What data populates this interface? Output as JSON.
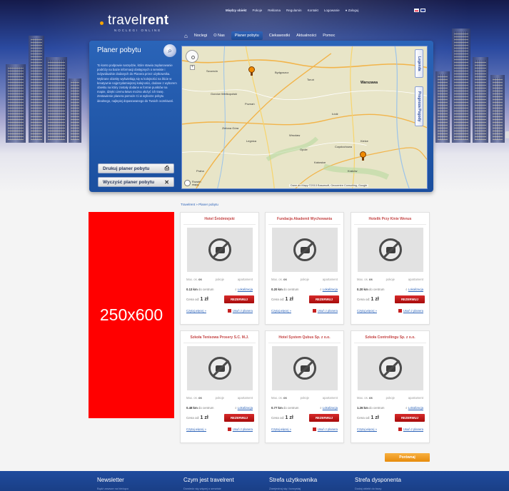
{
  "brand": {
    "name_light": "travel",
    "name_bold": "rent",
    "tagline": "NOCLEGI ONLINE",
    "accent": "#f7a400"
  },
  "top_nav": [
    "Między obiekt",
    "Pokoje",
    "Reklama",
    "Regulamin",
    "Kontakt",
    "Logowanie",
    "Zaloguj"
  ],
  "language_flags": [
    "pl",
    "en"
  ],
  "main_nav": {
    "home_icon": "home-icon",
    "items": [
      "Noclegi",
      "O Nas",
      "Planer pobytu",
      "Ciekawostki",
      "Aktualności",
      "Pomoc"
    ],
    "active": "Planer pobytu"
  },
  "planner": {
    "title": "Planer pobytu",
    "description": "To konto podpowie narzędzie, które stawia zaplanowanie podróży na bazie informacji dostępnych o serwisie i indywidualnie dodanych do Planera przez użytkownika. Wybrane obiekty wyświetlają się w kolejności na liście w kreatywnie najprzydatniejszej kolejności, dodane z wyborem obiektu na który zostały dodane w formie punktów na mapie, dzięki czemu łatwo można ułożyć ich trasę. Zestawienie planera pomoże Ci w wyborze pobytu idealnego, najlepiej dopasowanego do Twoich oczekiwań.",
    "buttons": {
      "print": "Drukuj planer pobytu",
      "clear": "Wyczyść planer pobytu"
    },
    "side_tabs": [
      "Legenda",
      "Prognoza Pogody"
    ],
    "map_attribution": "Dane do Mapy ©2013 Basarsoft, Geocentre Consulting, Google",
    "map_label": "Rozwiń mapę"
  },
  "map_places": [
    "Szczecin",
    "Gorzów Wielkopolski",
    "Poznań",
    "Zielona Góra",
    "Wrocław",
    "Łódź",
    "Warszawa",
    "Kielce",
    "Opole",
    "Katowice",
    "Kraków",
    "Częstochowa",
    "Praha",
    "Bydgoszcz",
    "Toruń",
    "Legnica"
  ],
  "breadcrumb": "Travelrent » Planer pobytu",
  "ad_placeholder": "250x600",
  "listing_labels": {
    "feature_1": "Max. os.",
    "feature_2": "pokoje",
    "feature_3": "apartament",
    "distance_suffix": "do centrum",
    "locate": "Lokalizacja",
    "price_prefix": "Cena od:",
    "reserve": "REZERWUJ",
    "more": "Czytaj więcej »",
    "remove": "Usuń z planera"
  },
  "listings": [
    {
      "name": "Hotel Śródmiejski",
      "distance": "0.13 km",
      "max_os": "os",
      "price": "1 zł"
    },
    {
      "name": "Fundacja Akademii Wychowania",
      "distance": "0.20 km",
      "max_os": "os",
      "price": "1 zł"
    },
    {
      "name": "Hotelik Przy Kinie Wenus",
      "distance": "0.20 km",
      "max_os": "os",
      "price": "1 zł"
    },
    {
      "name": "Szkoła Tenisowa Prosery S.C. M.J.",
      "distance": "0.48 km",
      "max_os": "os",
      "price": "1 zł"
    },
    {
      "name": "Hotel System Qubus Sp. z o.o.",
      "distance": "0.77 km",
      "max_os": "os",
      "price": "1 zł"
    },
    {
      "name": "Szkoła Controllingu Sp. z o.o.",
      "distance": "1.26 km",
      "max_os": "os",
      "price": "1 zł"
    }
  ],
  "compare_button": "Porównaj",
  "footer": {
    "columns": [
      {
        "title": "Newsletter",
        "sub": "Bądź zawsze na bieżąco"
      },
      {
        "title": "Czym jest travelrent",
        "sub": "Dowiedz się więcej o serwisie"
      },
      {
        "title": "Strefa użytkownika",
        "sub": "Zarejestruj się i korzystaj"
      },
      {
        "title": "Strefa dysponenta",
        "sub": "Dodaj obiekt do bazy"
      }
    ]
  },
  "colors": {
    "brand_blue": "#1f4d98",
    "reserve_red": "#c62121",
    "compare_orange": "#f29a1f",
    "ad_red": "#ff0000"
  }
}
